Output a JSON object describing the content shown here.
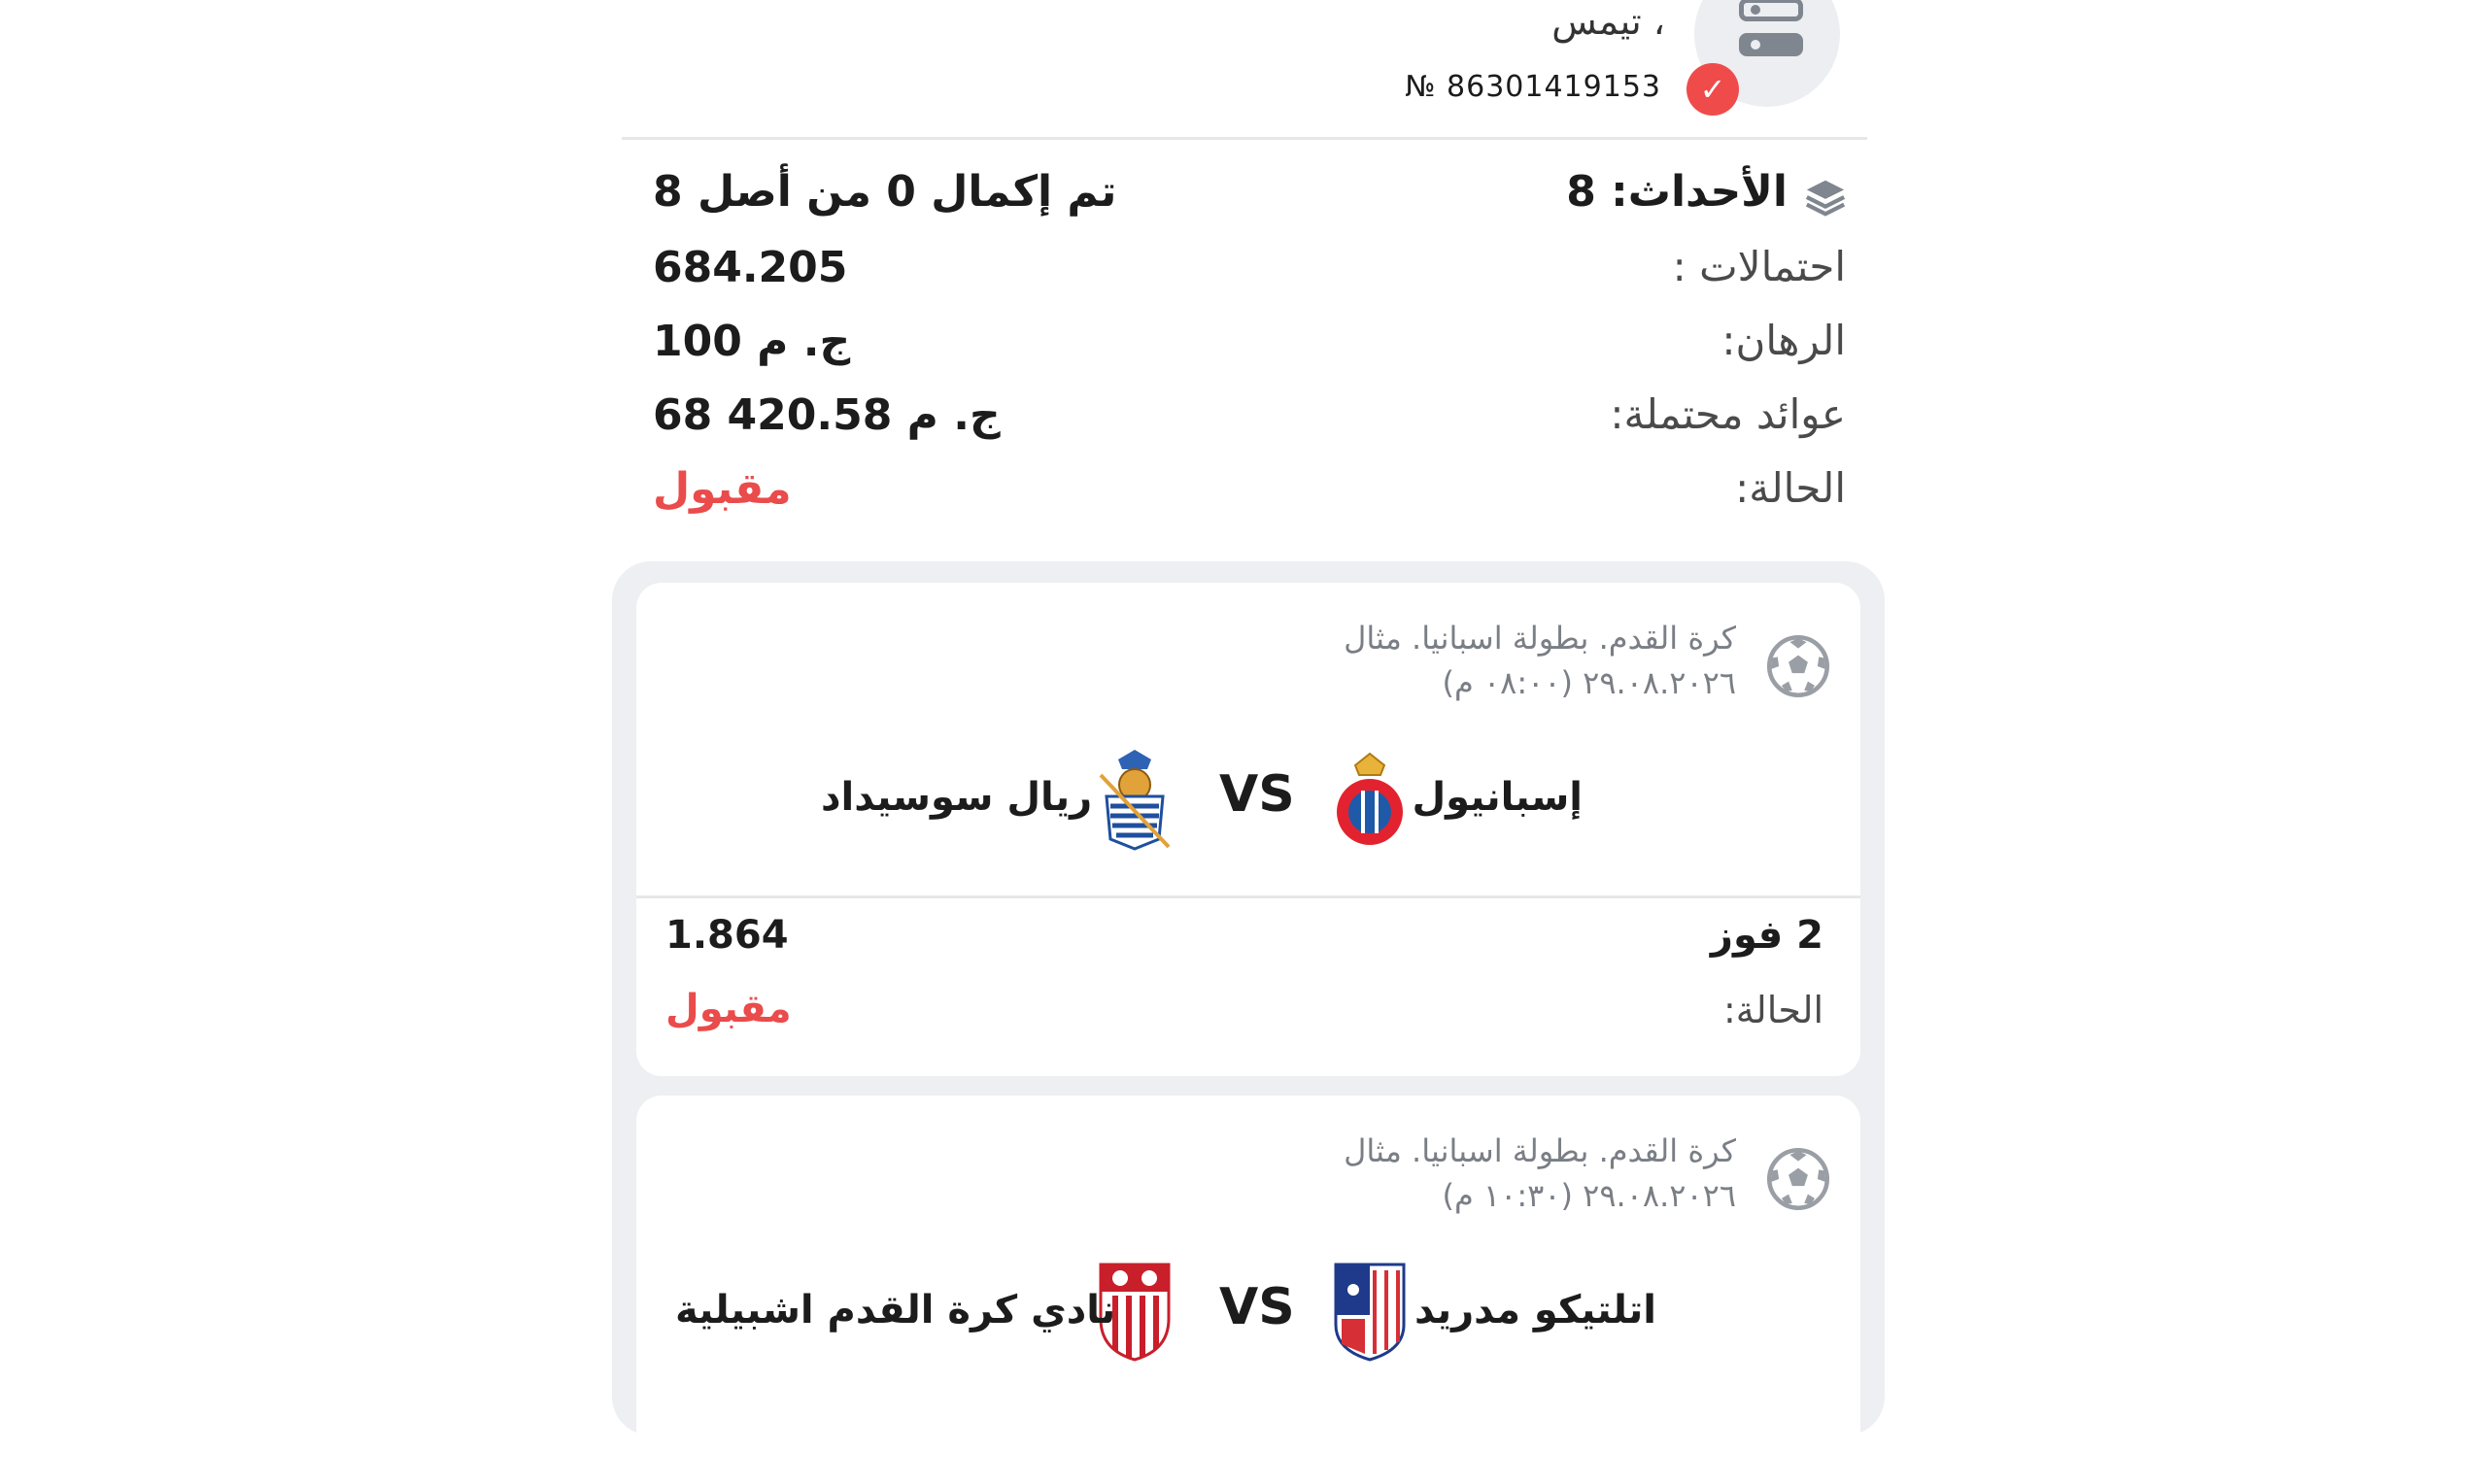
{
  "header": {
    "user_name": "تيمس ،",
    "ticket_number": "№ 86301419153",
    "verified": true
  },
  "summary": {
    "events_label": "الأحداث: 8",
    "progress_text": "تم إكمال 0 من أصل 8",
    "odds_label": "احتمالات :",
    "odds_value": "684.205",
    "stake_label": "الرهان:",
    "stake_value": "100 ج. م",
    "payout_label": "عوائد محتملة:",
    "payout_value": "68 420.58 ج. م",
    "status_label": "الحالة:",
    "status_value": "مقبول"
  },
  "bets": [
    {
      "league": "كرة القدم. بطولة اسبانيا. مثال",
      "datetime": "٢٩.٠٨.٢٠٢٦ (٠٨:٠٠ م)",
      "home_team": "إسبانيول",
      "away_team": "ريال سوسيداد",
      "vs": "VS",
      "pick": "2 فوز",
      "odds": "1.864",
      "status_label": "الحالة:",
      "status_value": "مقبول"
    },
    {
      "league": "كرة القدم. بطولة اسبانيا. مثال",
      "datetime": "٢٩.٠٨.٢٠٢٦ (١٠:٣٠ م)",
      "home_team": "اتلتيكو مدريد",
      "away_team": "نادي كرة القدم اشبيلية",
      "vs": "VS"
    }
  ],
  "colors": {
    "accent": "#ea4b4b",
    "container_bg": "#edeff2",
    "muted_text": "#7a7e85"
  },
  "icons": {
    "header": "bet-slip-icon",
    "verified": "check-circle-icon",
    "events": "layers-icon",
    "sport": "soccer-ball-icon"
  }
}
